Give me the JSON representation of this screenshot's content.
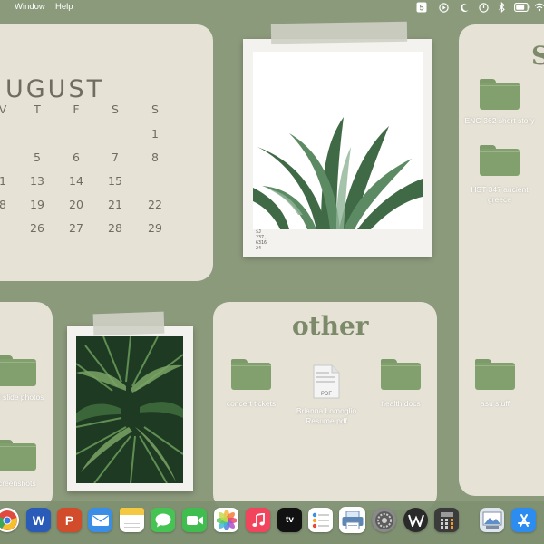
{
  "menubar": {
    "items": [
      "Window",
      "Help"
    ],
    "status_icons": [
      "calendar-5-icon",
      "play-circle-icon",
      "moon-icon",
      "power-icon",
      "bluetooth-icon",
      "battery-icon",
      "wifi-icon"
    ],
    "calendar_badge": "5"
  },
  "calendar": {
    "month": "UGUST",
    "weekdays": [
      "V",
      "T",
      "F",
      "S",
      "S"
    ],
    "weeks": [
      [
        "",
        "",
        "",
        "",
        "1"
      ],
      [
        "",
        "5",
        "6",
        "7",
        "8"
      ],
      [
        "1",
        "13",
        "14",
        "15",
        ""
      ],
      [
        "8",
        "19",
        "20",
        "21",
        "22"
      ],
      [
        "",
        "26",
        "27",
        "28",
        "29"
      ]
    ]
  },
  "school_panel": {
    "title": "S",
    "folders": [
      {
        "label": "ENG 362 short story"
      },
      {
        "label": "HST 347 ancient greece"
      }
    ]
  },
  "other_panel": {
    "title": "other",
    "folders": [
      {
        "label": "concert tickets"
      },
      {
        "label": "health docs"
      }
    ],
    "file": {
      "label": "Brianna Lomoglio Resume.pdf",
      "type": "PDF"
    }
  },
  "left_panel": {
    "folders": [
      {
        "label": "d slide photos"
      },
      {
        "label": "creenshots"
      }
    ]
  },
  "desktop_folders": [
    {
      "label": "asu stuff"
    }
  ],
  "polaroid_top": {
    "note": "$J\n237,\n6316\n24"
  },
  "dock": {
    "apps": [
      "chrome",
      "word",
      "powerpoint",
      "mail",
      "notes",
      "messages",
      "facetime",
      "photos",
      "music",
      "tv",
      "reminders",
      "printer",
      "system-preferences",
      "wolfram",
      "calculator",
      "preview",
      "app-store"
    ],
    "labels": {
      "word": "W",
      "powerpoint": "P",
      "tv": "tv",
      "pdf": "PDF"
    }
  },
  "colors": {
    "background": "#8c9a7c",
    "panel": "#e6e2d6",
    "folder": "#82a06e",
    "title_green": "#7c8a6a"
  }
}
